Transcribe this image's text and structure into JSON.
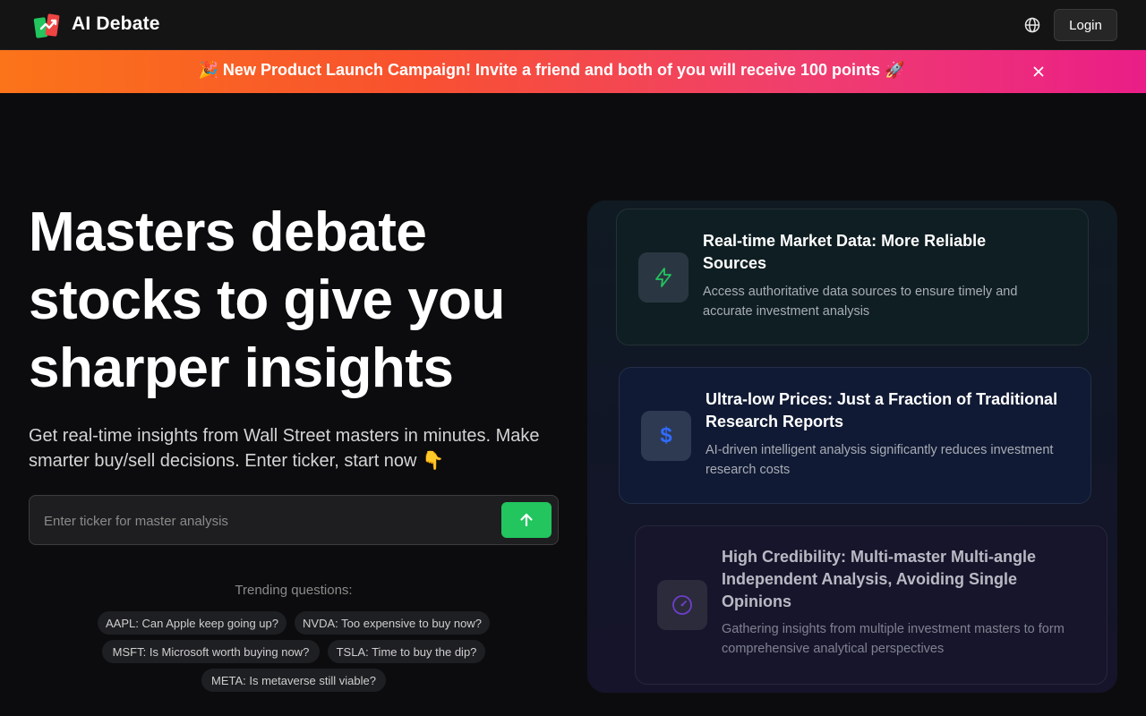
{
  "header": {
    "brand": "AI Debate",
    "login_label": "Login",
    "language_icon": "globe-icon"
  },
  "banner": {
    "text": "🎉 New Product Launch Campaign! Invite a friend and both of you will receive 100 points 🚀",
    "close_icon": "close-icon",
    "colors": {
      "start": "#fb7419",
      "end": "#ea1e87"
    }
  },
  "hero": {
    "title": "Masters debate stocks to give you sharper insights",
    "subtitle": "Get real-time insights from Wall Street masters in minutes. Make smarter buy/sell decisions. Enter ticker, start now 👇",
    "search_placeholder": "Enter ticker for master analysis",
    "submit_icon": "arrow-up-icon",
    "accent": "#22c55e"
  },
  "trending": {
    "label": "Trending questions:",
    "items": [
      "AAPL: Can Apple keep going up?",
      "NVDA: Too expensive to buy now?",
      "MSFT: Is Microsoft worth buying now?",
      "TSLA: Time to buy the dip?",
      "META: Is metaverse still viable?"
    ]
  },
  "features": [
    {
      "icon": "lightning-icon",
      "title": "Real-time Market Data: More Reliable Sources",
      "description": "Access authoritative data sources to ensure timely and accurate investment analysis",
      "accent": "#22c55e"
    },
    {
      "icon": "dollar-icon",
      "title": "Ultra-low Prices: Just a Fraction of Traditional Research Reports",
      "description": "AI-driven intelligent analysis significantly reduces investment research costs",
      "accent": "#2f6bff"
    },
    {
      "icon": "gauge-icon",
      "title": "High Credibility: Multi-master Multi-angle Independent Analysis, Avoiding Single Opinions",
      "description": "Gathering insights from multiple investment masters to form comprehensive analytical perspectives",
      "accent": "#7c3aed"
    }
  ]
}
